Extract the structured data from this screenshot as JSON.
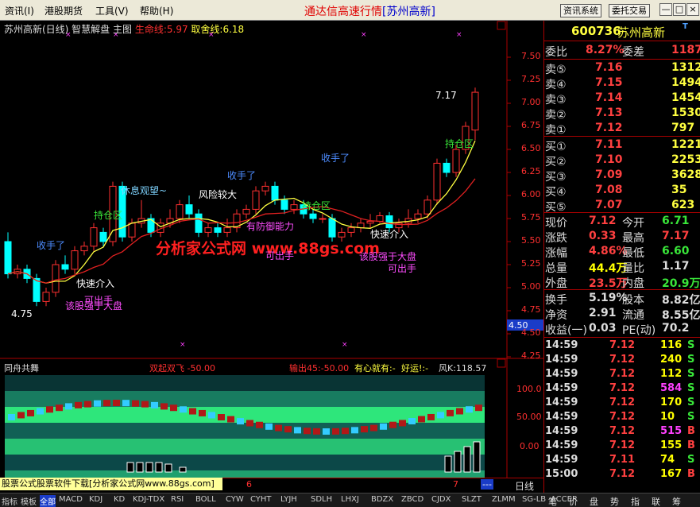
{
  "menubar": {
    "items": [
      "资讯(I)",
      "港股期货",
      "工具(V)",
      "帮助(H)"
    ],
    "title": "通达信高速行情",
    "title_bracket": "[苏州高新]",
    "btn_info": "资讯系统",
    "btn_trade": "委托交易",
    "win_min": "—",
    "win_max": "□",
    "win_close": "×"
  },
  "chart_header": {
    "name": "苏州高新(日线) 智慧解盘 主图",
    "life_label": "生命线:",
    "life_value": "5.97",
    "take_label": "取舍线:",
    "take_value": "6.18"
  },
  "price_axis": [
    "7.50",
    "7.25",
    "7.00",
    "6.75",
    "6.50",
    "6.25",
    "6.00",
    "5.75",
    "5.50",
    "5.25",
    "5.00",
    "4.75",
    "4.50",
    "4.25"
  ],
  "current_tag": "4.50",
  "watermark": "分析家公式网 www.88gs.com",
  "annotations": [
    {
      "text": "休息观望~",
      "color": "#7fd4ff"
    },
    {
      "text": "风险较大",
      "color": "#ffffff"
    },
    {
      "text": "收手了",
      "color": "#4d8cff"
    },
    {
      "text": "收手了",
      "color": "#4d8cff"
    },
    {
      "text": "收手了",
      "color": "#4d8cff"
    },
    {
      "text": "持仓区",
      "color": "#39e639"
    },
    {
      "text": "持仓区",
      "color": "#39e639"
    },
    {
      "text": "持仓区",
      "color": "#39e639"
    },
    {
      "text": "快速介入",
      "color": "#ffffff"
    },
    {
      "text": "快速介入",
      "color": "#ffffff"
    },
    {
      "text": "该股强于大盘",
      "color": "#ff4dff"
    },
    {
      "text": "该股强于大盘",
      "color": "#ff4dff"
    },
    {
      "text": "有防御能力",
      "color": "#ff4dff"
    },
    {
      "text": "可出手",
      "color": "#ff4dff"
    },
    {
      "text": "可出手",
      "color": "#ff4dff"
    },
    {
      "text": "可出手",
      "color": "#ff4dff"
    },
    {
      "text": "7.17",
      "color": "#ffffff"
    },
    {
      "text": "4.75",
      "color": "#ffffff"
    }
  ],
  "indicator": {
    "name": "同舟共舞",
    "l1": "双起双飞 -50.00",
    "l2": "输出45:-50.00",
    "l3": "有心就有:-",
    "l4": "好运!:-",
    "l5": "风K:118.57",
    "axis": [
      "100.0",
      "50.00",
      "0.00"
    ]
  },
  "ad_text": "股票公式股票软件下载[分析家公式网www.88gs.com]",
  "timebar": {
    "mark6": "6",
    "mark7": "7",
    "cycle": "日线",
    "dashes": "---"
  },
  "quote": {
    "code": "600736",
    "name": "苏州高新",
    "weibi_label": "委比",
    "weibi": "8.27%",
    "weicha_label": "委差",
    "weicha": "1187",
    "asks": [
      {
        "label": "卖⑤",
        "price": "7.16",
        "vol": "1312"
      },
      {
        "label": "卖④",
        "price": "7.15",
        "vol": "1494"
      },
      {
        "label": "卖③",
        "price": "7.14",
        "vol": "1454"
      },
      {
        "label": "卖②",
        "price": "7.13",
        "vol": "1530"
      },
      {
        "label": "卖①",
        "price": "7.12",
        "vol": "797"
      }
    ],
    "bids": [
      {
        "label": "买①",
        "price": "7.11",
        "vol": "1221"
      },
      {
        "label": "买②",
        "price": "7.10",
        "vol": "2253"
      },
      {
        "label": "买③",
        "price": "7.09",
        "vol": "3628"
      },
      {
        "label": "买④",
        "price": "7.08",
        "vol": "35"
      },
      {
        "label": "买⑤",
        "price": "7.07",
        "vol": "623"
      }
    ],
    "stats": [
      {
        "l1": "现价",
        "v1": "7.12",
        "c1": "#ff4040",
        "l2": "今开",
        "v2": "6.71",
        "c2": "#39e639"
      },
      {
        "l1": "涨跌",
        "v1": "0.33",
        "c1": "#ff4040",
        "l2": "最高",
        "v2": "7.17",
        "c2": "#ff4040"
      },
      {
        "l1": "涨幅",
        "v1": "4.86%",
        "c1": "#ff4040",
        "l2": "最低",
        "v2": "6.60",
        "c2": "#39e639"
      },
      {
        "l1": "总量",
        "v1": "44.4万",
        "c1": "#ffff00",
        "l2": "量比",
        "v2": "1.17",
        "c2": "#dddddd"
      },
      {
        "l1": "外盘",
        "v1": "23.5万",
        "c1": "#ff4040",
        "l2": "内盘",
        "v2": "20.9万",
        "c2": "#39e639"
      }
    ],
    "stats2": [
      {
        "l1": "换手",
        "v1": "5.19%",
        "c1": "#dddddd",
        "l2": "股本",
        "v2": "8.82亿",
        "c2": "#dddddd"
      },
      {
        "l1": "净资",
        "v1": "2.91",
        "c1": "#dddddd",
        "l2": "流通",
        "v2": "8.55亿",
        "c2": "#dddddd"
      },
      {
        "l1": "收益(一)",
        "v1": "0.03",
        "c1": "#dddddd",
        "l2": "PE(动)",
        "v2": "70.2",
        "c2": "#dddddd"
      }
    ],
    "ticks": [
      {
        "t": "14:59",
        "p": "7.12",
        "v": "116",
        "s": "S",
        "vc": "#ffff00",
        "sc": "#39e639"
      },
      {
        "t": "14:59",
        "p": "7.12",
        "v": "240",
        "s": "S",
        "vc": "#ffff00",
        "sc": "#39e639"
      },
      {
        "t": "14:59",
        "p": "7.12",
        "v": "112",
        "s": "S",
        "vc": "#ffff00",
        "sc": "#39e639"
      },
      {
        "t": "14:59",
        "p": "7.12",
        "v": "584",
        "s": "S",
        "vc": "#ff40ff",
        "sc": "#39e639"
      },
      {
        "t": "14:59",
        "p": "7.12",
        "v": "170",
        "s": "S",
        "vc": "#ffff00",
        "sc": "#39e639"
      },
      {
        "t": "14:59",
        "p": "7.12",
        "v": "10",
        "s": "S",
        "vc": "#ffff00",
        "sc": "#39e639"
      },
      {
        "t": "14:59",
        "p": "7.12",
        "v": "515",
        "s": "B",
        "vc": "#ff40ff",
        "sc": "#ff4040"
      },
      {
        "t": "14:59",
        "p": "7.12",
        "v": "155",
        "s": "B",
        "vc": "#ffff00",
        "sc": "#ff4040"
      },
      {
        "t": "14:59",
        "p": "7.11",
        "v": "74",
        "s": "S",
        "vc": "#ffff00",
        "sc": "#39e639"
      },
      {
        "t": "15:00",
        "p": "7.12",
        "v": "167",
        "s": "B",
        "vc": "#ffff00",
        "sc": "#ff4040"
      }
    ]
  },
  "bottom_tabs": [
    "指标",
    "模板",
    "全部",
    "MACD",
    "KDJ",
    "KD",
    "KDJ-TDX",
    "RSI",
    "BOLL",
    "CYW",
    "CYHT",
    "LYJH",
    "SDLH",
    "LHXJ",
    "BDZX",
    "ZBCD",
    "CJDX",
    "SLZT",
    "ZLMM",
    "SG-LB",
    "ACCER"
  ],
  "right_tabs": [
    "笔",
    "价",
    "盘",
    "势",
    "指",
    "联",
    "筹"
  ]
}
